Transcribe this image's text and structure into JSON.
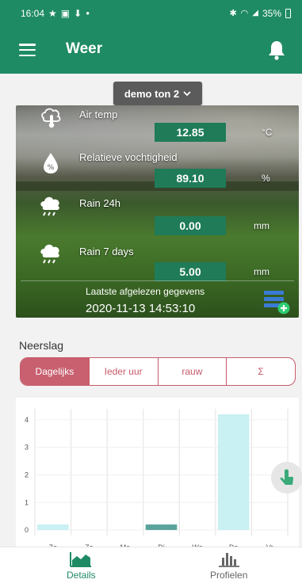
{
  "status_bar": {
    "time": "16:04",
    "left_icons": [
      "star-icon",
      "image-icon",
      "download-icon",
      "dot-icon"
    ],
    "right_icons": [
      "bluetooth-icon",
      "wifi-icon",
      "signal-icon"
    ],
    "battery": "35%"
  },
  "app_bar": {
    "title": "Weer"
  },
  "device_selector": {
    "value": "demo ton 2",
    "icon": "chevron-down-icon"
  },
  "weather": {
    "rows": [
      {
        "icon": "thermometer-cloud-icon",
        "label": "Air temp",
        "value": "12.85",
        "unit": "°C"
      },
      {
        "icon": "droplet-percent-icon",
        "label": "Relatieve vochtigheid",
        "value": "89.10",
        "unit": "%"
      },
      {
        "icon": "rain-cloud-icon",
        "label": "Rain 24h",
        "value": "0.00",
        "unit": "mm"
      },
      {
        "icon": "rain-cloud-icon",
        "label": "Rain 7 days",
        "value": "5.00",
        "unit": "mm"
      }
    ],
    "last_read_label": "Laatste afgelezen gegevens",
    "last_read_time": "2020-11-13 14:53:10"
  },
  "precipitation": {
    "title": "Neerslag",
    "tabs": [
      {
        "label": "Dagelijks",
        "active": true
      },
      {
        "label": "Ieder uur",
        "active": false
      },
      {
        "label": "rauw",
        "active": false
      },
      {
        "label": "Σ",
        "active": false
      }
    ]
  },
  "chart_data": {
    "type": "bar",
    "title": "",
    "xlabel": "",
    "ylabel": "",
    "ylim": [
      -0.2,
      4.4
    ],
    "yticks": [
      0,
      1,
      2,
      3,
      4
    ],
    "categories": [
      "Zo",
      "Zo",
      "Ma",
      "Di",
      "Wo",
      "Do",
      "Vr"
    ],
    "values": [
      0.2,
      0,
      0,
      0.2,
      0,
      4.2,
      0
    ],
    "colors": [
      "#c9f0f3",
      "#c9f0f3",
      "#c9f0f3",
      "#5aa39c",
      "#c9f0f3",
      "#c9f0f3",
      "#c9f0f3"
    ],
    "grid": true
  },
  "bottom_nav": [
    {
      "label": "Details",
      "icon": "chart-area-icon",
      "active": true
    },
    {
      "label": "Profielen",
      "icon": "bar-chart-icon",
      "active": false
    }
  ],
  "colors": {
    "primary": "#1f8b64",
    "accent": "#c8606f",
    "value_box": "#1f7b58"
  }
}
